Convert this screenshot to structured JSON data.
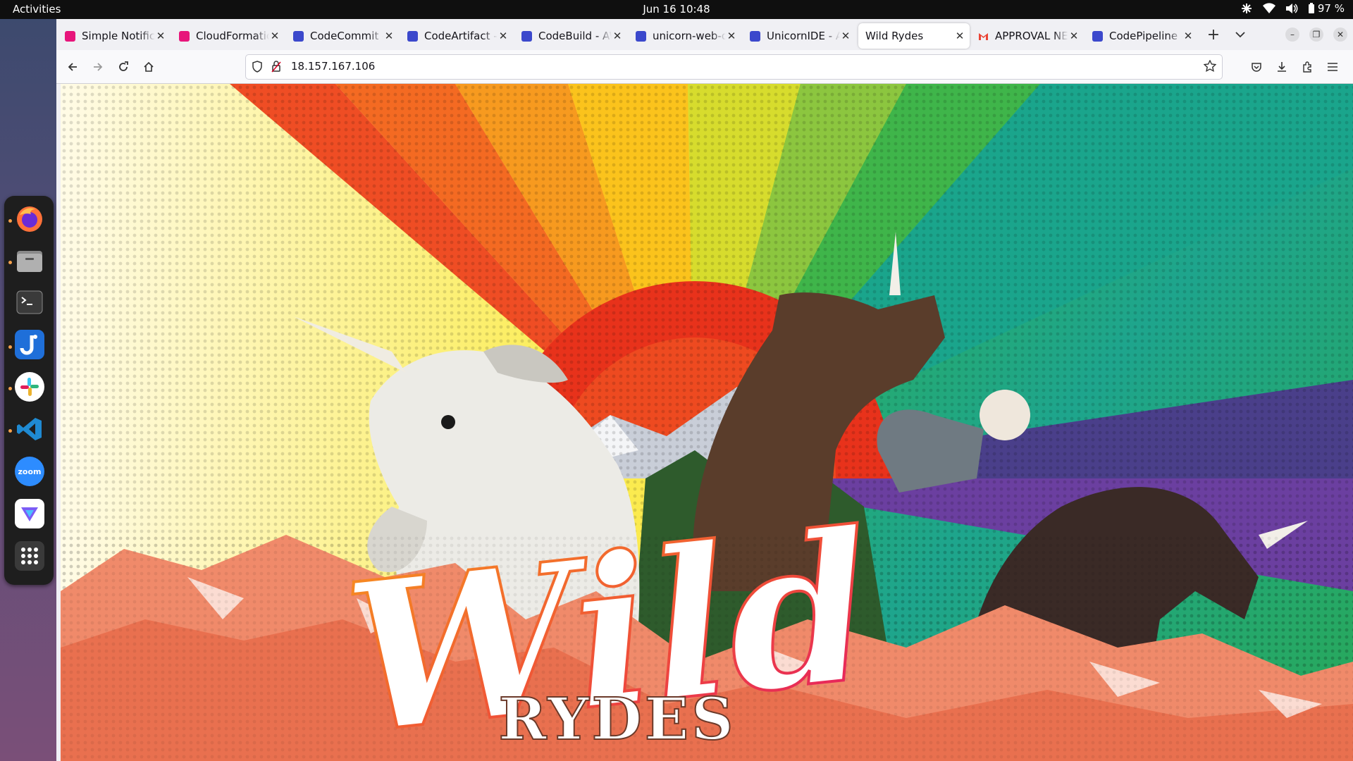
{
  "system_bar": {
    "activities": "Activities",
    "clock": "Jun 16  10:48",
    "battery": "97 %",
    "icons": [
      "network-icon",
      "wifi-icon",
      "volume-icon",
      "battery-icon"
    ]
  },
  "dock": {
    "items": [
      {
        "name": "firefox-icon",
        "running": true
      },
      {
        "name": "files-icon",
        "running": true
      },
      {
        "name": "terminal-icon",
        "running": false
      },
      {
        "name": "joplin-icon",
        "running": true
      },
      {
        "name": "slack-icon",
        "running": true
      },
      {
        "name": "vscode-icon",
        "running": true
      },
      {
        "name": "zoom-icon",
        "label": "zoom",
        "running": false
      },
      {
        "name": "app-icon",
        "running": false
      },
      {
        "name": "show-apps-icon",
        "running": false
      }
    ]
  },
  "browser": {
    "tabs": [
      {
        "title": "Simple Notifica",
        "favicon_color": "#e7157b"
      },
      {
        "title": "CloudFormation",
        "favicon_color": "#e7157b"
      },
      {
        "title": "CodeCommit - A",
        "favicon_color": "#3b48cc"
      },
      {
        "title": "CodeArtifact - A",
        "favicon_color": "#3b48cc"
      },
      {
        "title": "CodeBuild - AW",
        "favicon_color": "#3b48cc"
      },
      {
        "title": "unicorn-web-de",
        "favicon_color": "#3b48cc"
      },
      {
        "title": "UnicornIDE - AW",
        "favicon_color": "#3b48cc"
      },
      {
        "title": "Wild Rydes",
        "favicon_color": "",
        "active": true
      },
      {
        "title": "APPROVAL NEE",
        "favicon_color": "#ea4335"
      },
      {
        "title": "CodePipeline - A",
        "favicon_color": "#3b48cc"
      }
    ],
    "url": "18.157.167.106",
    "toolbar_icons": [
      "back-icon",
      "forward-icon",
      "reload-icon",
      "home-icon",
      "shield-icon",
      "insecure-lock-icon",
      "bookmark-star-icon",
      "pocket-icon",
      "download-icon",
      "extensions-icon",
      "menu-icon"
    ]
  },
  "page": {
    "logo_wild": "Wild",
    "logo_rydes": "RYDES",
    "colors": {
      "yellow": "#f8e33a",
      "orange": "#f39a1e",
      "red": "#e8321b",
      "green": "#39b54a",
      "teal": "#1fa7a0",
      "purple": "#6a3fa0",
      "mountain": "#f08a6a"
    }
  }
}
